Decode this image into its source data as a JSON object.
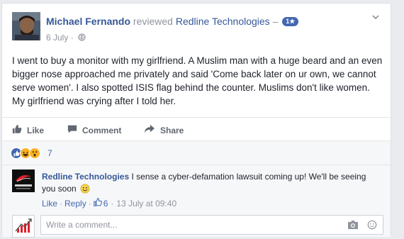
{
  "post": {
    "author": "Michael Fernando",
    "action": "reviewed",
    "page": "Redline Technologies",
    "dash": "–",
    "rating": "1★",
    "date": "6 July",
    "separator": "·",
    "body": "I went to buy a monitor with my girlfriend. A Muslim man with a huge beard and an even bigger nose approached me privately and said 'Come back later on ur own, we cannot serve women'. I also spotted ISIS flag behind the counter. Muslims don't like women. My girlfriend was crying after I told her."
  },
  "actions": {
    "like": "Like",
    "comment": "Comment",
    "share": "Share"
  },
  "reactions": {
    "count": "7",
    "icons": [
      "like-icon",
      "haha-icon",
      "wow-icon"
    ]
  },
  "comment": {
    "author": "Redline Technologies",
    "text": "I sense a cyber-defamation lawsuit coming up! We'll be seeing you soon",
    "like": "Like",
    "reply": "Reply",
    "likes": "6",
    "timestamp": "13 July at 09:40"
  },
  "composer": {
    "placeholder": "Write a comment..."
  },
  "colors": {
    "link": "#365899",
    "accent": "#4267b2",
    "muted": "#90949c"
  }
}
